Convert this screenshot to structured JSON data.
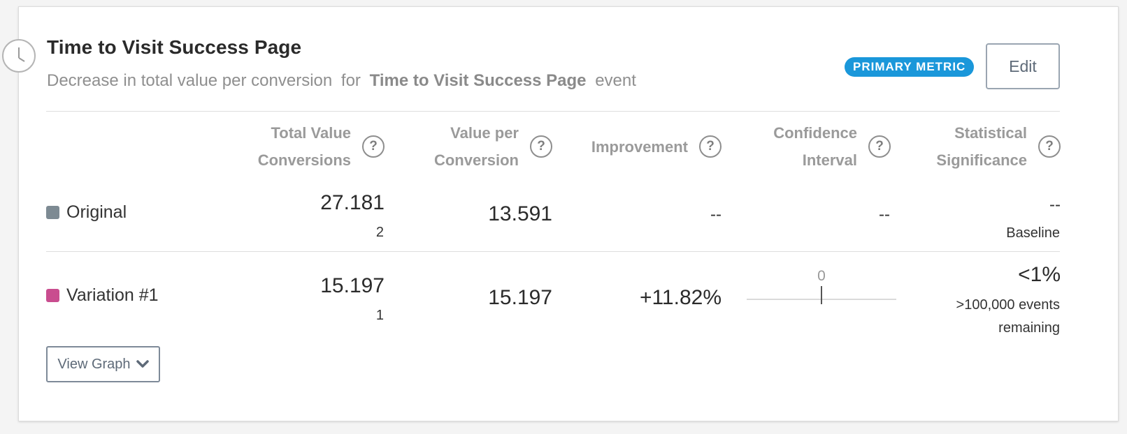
{
  "metric": {
    "title": "Time to Visit Success Page",
    "subtitle_prefix": "Decrease in total value per conversion",
    "subtitle_for": "for",
    "subtitle_event": "Time to Visit Success Page",
    "subtitle_suffix": "event",
    "badge": "PRIMARY METRIC",
    "edit_label": "Edit",
    "icon": "clock-icon"
  },
  "columns": [
    {
      "line1": "Total Value",
      "line2": "Conversions"
    },
    {
      "line1": "Value per",
      "line2": "Conversion"
    },
    {
      "line1": "Improvement",
      "line2": ""
    },
    {
      "line1": "Confidence",
      "line2": "Interval"
    },
    {
      "line1": "Statistical",
      "line2": "Significance"
    }
  ],
  "help_glyph": "?",
  "rows": [
    {
      "name": "Original",
      "color": "#7d8a93",
      "total_value": "27.181",
      "conversions": "2",
      "value_per_conversion": "13.591",
      "improvement": "--",
      "confidence_interval": "--",
      "significance": "--",
      "significance_note": "Baseline"
    },
    {
      "name": "Variation #1",
      "color": "#c94d8f",
      "total_value": "15.197",
      "conversions": "1",
      "value_per_conversion": "15.197",
      "improvement": "+11.82%",
      "confidence_interval_zero": "0",
      "significance": "<1%",
      "significance_note_1": ">100,000 events",
      "significance_note_2": "remaining"
    }
  ],
  "view_graph_label": "View Graph"
}
